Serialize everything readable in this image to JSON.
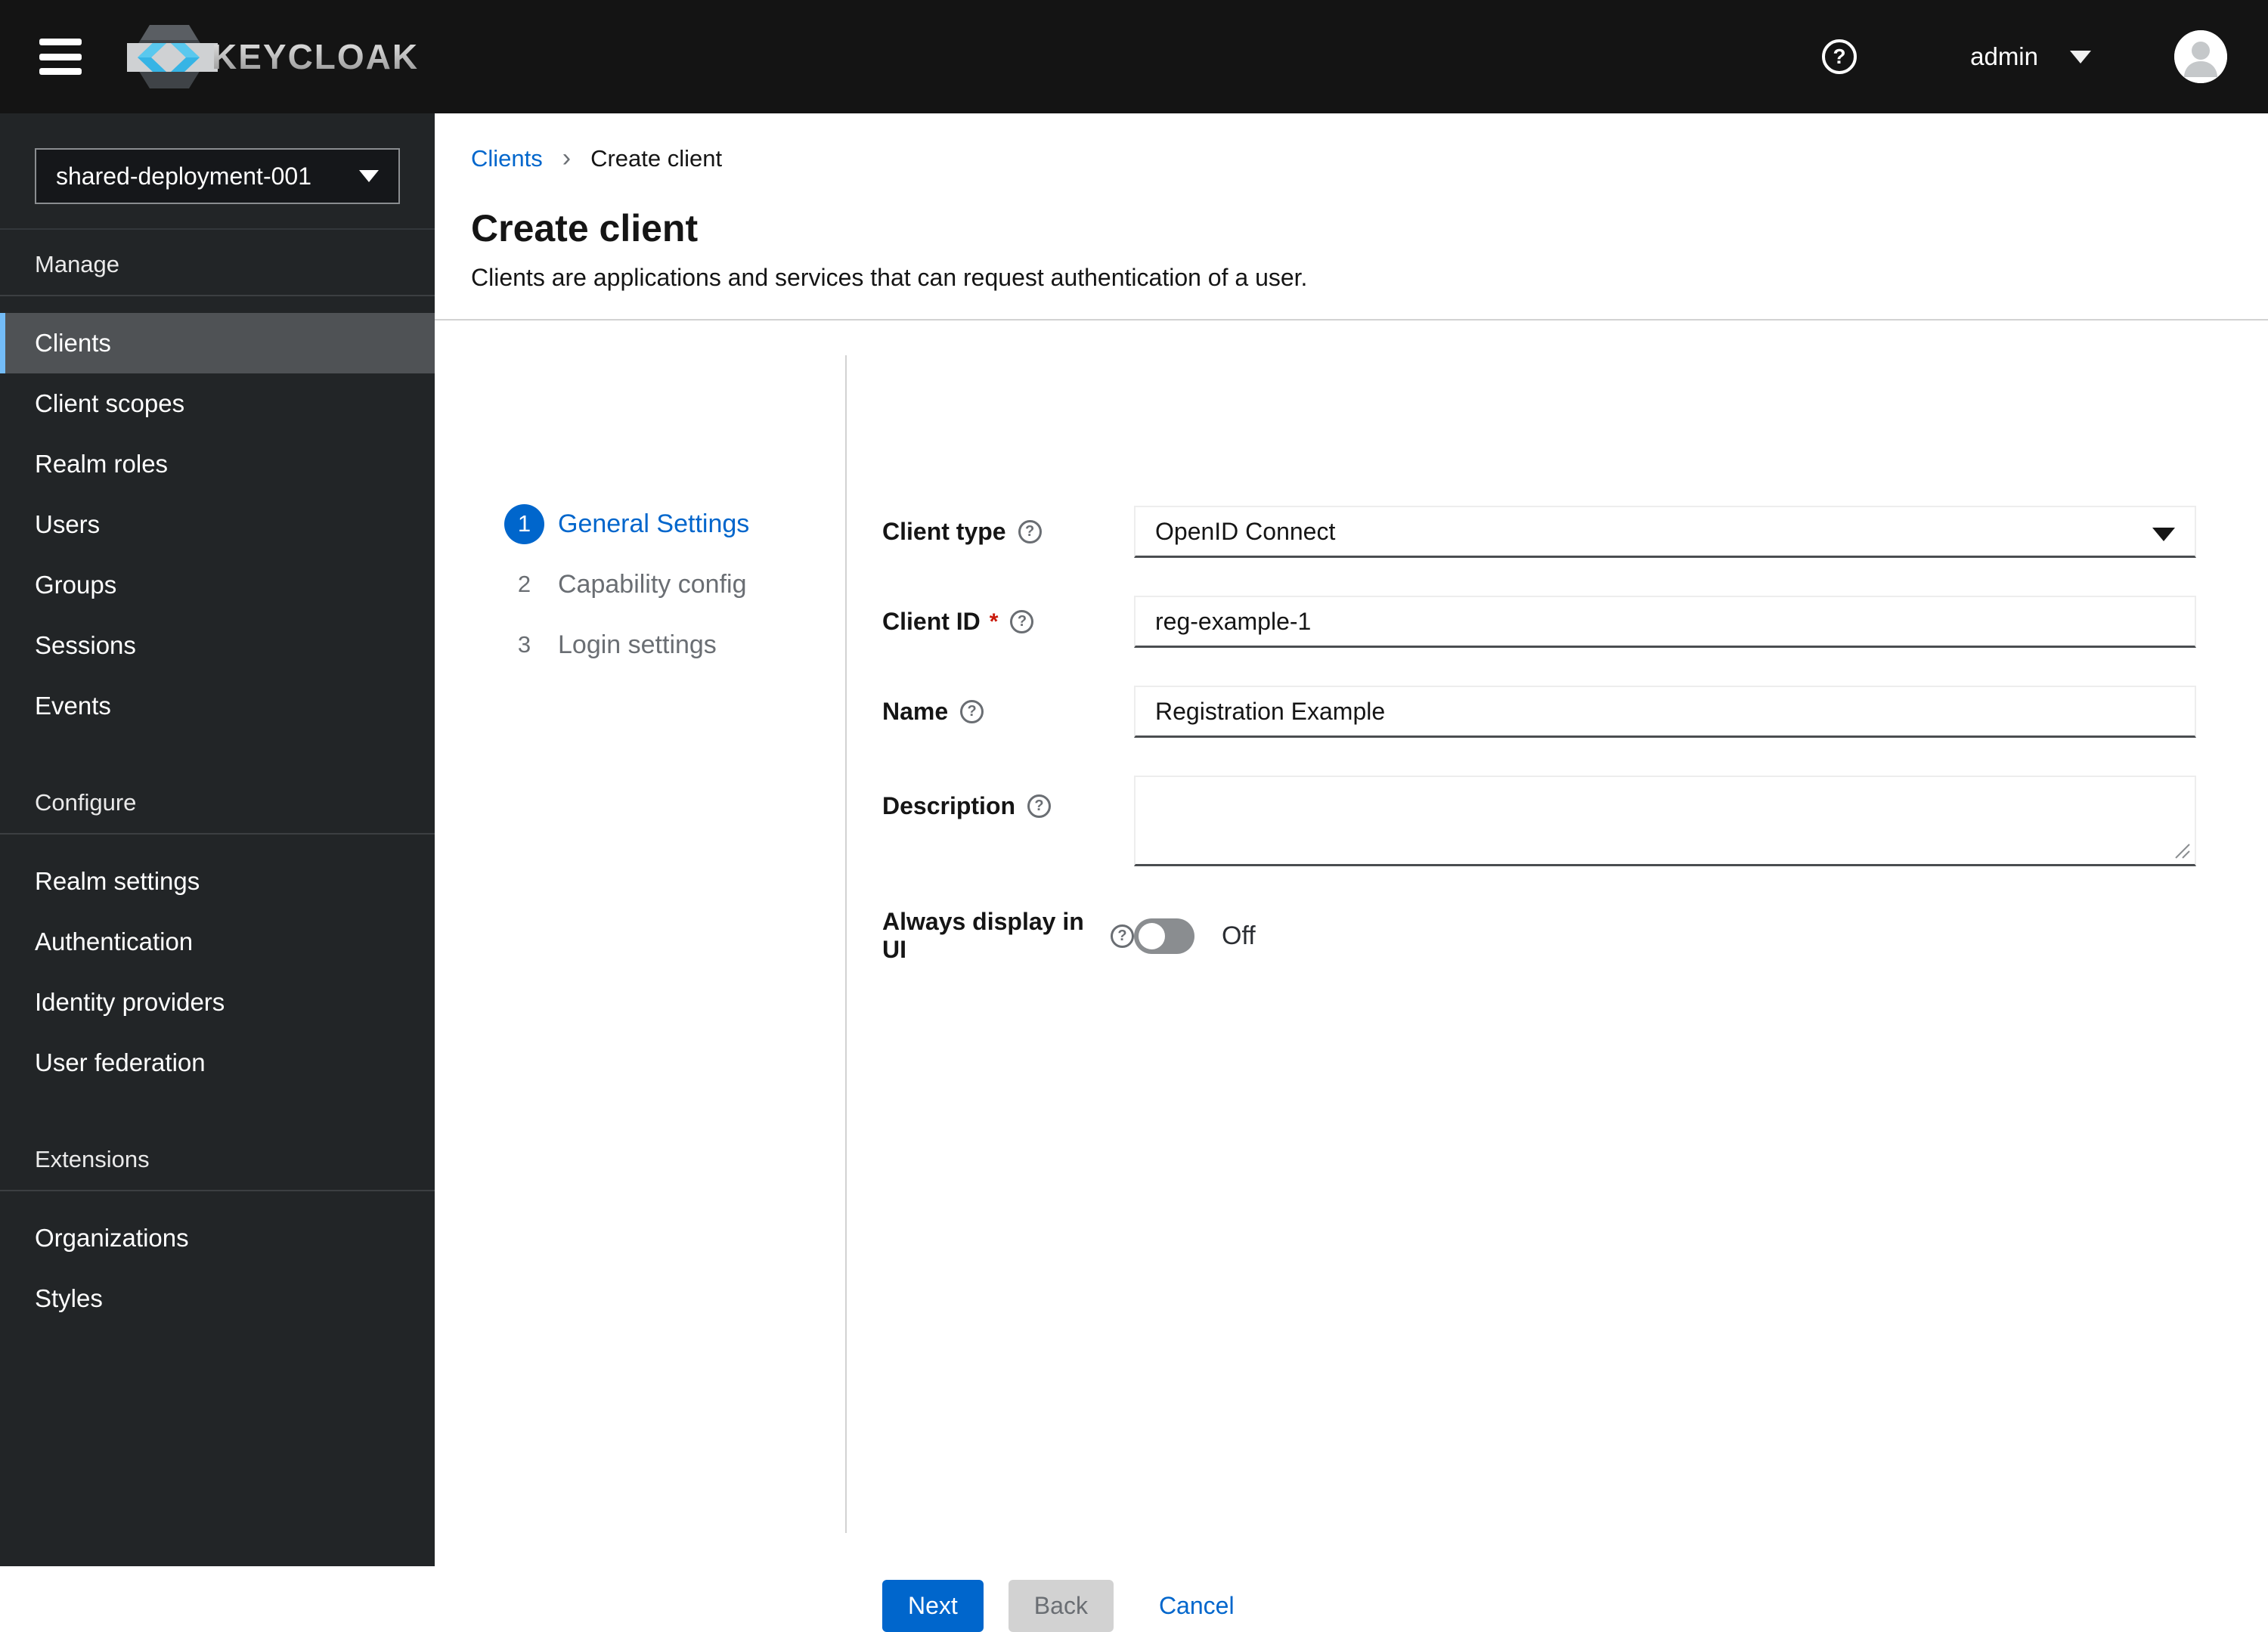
{
  "masthead": {
    "brand": "KEYCLOAK",
    "user": "admin"
  },
  "sidebar": {
    "realm_selector": {
      "value": "shared-deployment-001"
    },
    "sections": [
      {
        "title": "Manage",
        "items": [
          "Clients",
          "Client scopes",
          "Realm roles",
          "Users",
          "Groups",
          "Sessions",
          "Events"
        ],
        "active_item": "Clients"
      },
      {
        "title": "Configure",
        "items": [
          "Realm settings",
          "Authentication",
          "Identity providers",
          "User federation"
        ]
      },
      {
        "title": "Extensions",
        "items": [
          "Organizations",
          "Styles"
        ]
      }
    ]
  },
  "breadcrumb": {
    "parent": "Clients",
    "current": "Create client"
  },
  "page": {
    "title": "Create client",
    "subtitle": "Clients are applications and services that can request authentication of a user."
  },
  "wizard": {
    "steps": [
      {
        "number": "1",
        "label": "General Settings",
        "active": true
      },
      {
        "number": "2",
        "label": "Capability config",
        "active": false
      },
      {
        "number": "3",
        "label": "Login settings",
        "active": false
      }
    ]
  },
  "form": {
    "client_type": {
      "label": "Client type",
      "value": "OpenID Connect"
    },
    "client_id": {
      "label": "Client ID",
      "required": "*",
      "value": "reg-example-1"
    },
    "name": {
      "label": "Name",
      "value": "Registration Example"
    },
    "description": {
      "label": "Description",
      "value": ""
    },
    "always_display": {
      "label": "Always display in UI",
      "state": "Off"
    }
  },
  "actions": {
    "next": "Next",
    "back": "Back",
    "cancel": "Cancel"
  },
  "colors": {
    "primary": "#0066cc",
    "masthead_bg": "#141414",
    "sidebar_bg": "#222527",
    "active_nav_bg": "#4f5255",
    "active_nav_indicator": "#73bcf7",
    "danger": "#c9190b",
    "divider": "#d2d2d2"
  }
}
